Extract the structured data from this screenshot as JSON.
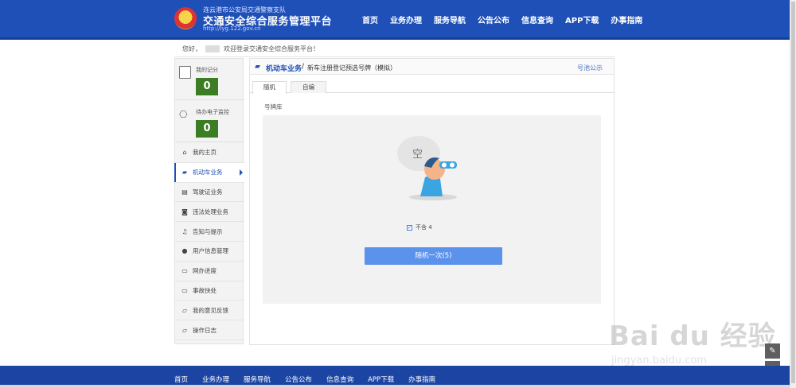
{
  "header": {
    "org": "连云港市公安局交通警察支队",
    "title": "交通安全综合服务管理平台",
    "url": "http://lyg.122.gov.cn",
    "nav": [
      "首页",
      "业务办理",
      "服务导航",
      "公告公布",
      "信息查询",
      "APP下载",
      "办事指南"
    ]
  },
  "greeting": {
    "hello": "您好，",
    "welcome": "欢迎登录交通安全综合服务平台！"
  },
  "sidebar": {
    "stats": [
      {
        "label": "我的记分",
        "value": "0"
      },
      {
        "label": "待办电子监控",
        "value": "0"
      }
    ],
    "items": [
      {
        "label": "我的主页",
        "icon": "home-icon"
      },
      {
        "label": "机动车业务",
        "icon": "truck-icon"
      },
      {
        "label": "驾驶证业务",
        "icon": "license-card-icon"
      },
      {
        "label": "违法处理业务",
        "icon": "camera-icon"
      },
      {
        "label": "告知与提示",
        "icon": "bell-icon"
      },
      {
        "label": "用户信息管理",
        "icon": "user-icon"
      },
      {
        "label": "网办进度",
        "icon": "progress-icon"
      },
      {
        "label": "事故快处",
        "icon": "accident-icon"
      },
      {
        "label": "我的意见反馈",
        "icon": "feedback-icon"
      },
      {
        "label": "操作日志",
        "icon": "log-icon"
      }
    ],
    "active_index": 1
  },
  "main": {
    "breadcrumb_main": "机动车业务",
    "breadcrumb_sep": "/",
    "breadcrumb_sub": "新车注册登记预选号牌（模拟）",
    "right_link": "号池公示",
    "tabs": [
      "随机",
      "自编"
    ],
    "pool_label": "号牌库",
    "empty_text": "空",
    "checkbox_label": "不含 4",
    "checkbox_checked": true,
    "button_label": "随机一次(5)"
  },
  "footer": {
    "nav": [
      "首页",
      "业务办理",
      "服务导航",
      "公告公布",
      "信息查询",
      "APP下载",
      "办事指南"
    ]
  },
  "watermark": {
    "main": "Bai du 经验",
    "sub": "jingyan.baidu.com"
  },
  "colors": {
    "primary": "#1f50b8",
    "stat_box": "#3b7d23",
    "button": "#5b92ec"
  }
}
